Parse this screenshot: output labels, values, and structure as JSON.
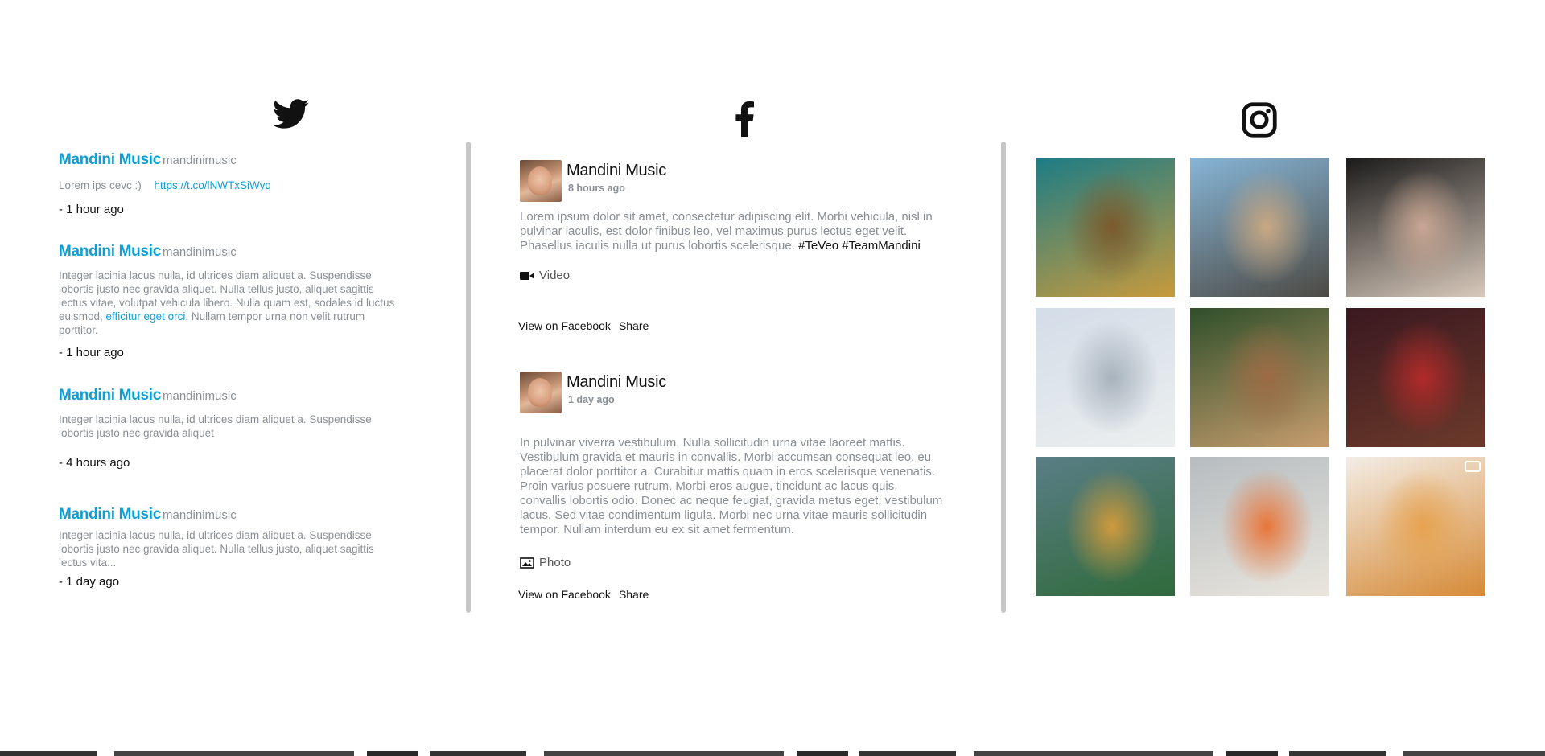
{
  "twitter": {
    "icon": "twitter-bird-icon",
    "tweets": [
      {
        "name": "Mandini Music",
        "handle": "mandinimusic",
        "text": "Lorem ips cevc :) ",
        "link": "https://t.co/lNWTxSiWyq",
        "time": "- 1 hour ago"
      },
      {
        "name": "Mandini Music",
        "handle": "mandinimusic",
        "text": "Integer lacinia lacus nulla, id ultrices diam aliquet a. Suspendisse lobortis justo nec gravida aliquet. Nulla tellus justo, aliquet sagittis lectus vitae, volutpat vehicula libero. Nulla quam est, sodales id luctus euismod, ",
        "link": "efficitur eget orci",
        "text_after": ". Nullam tempor urna non velit rutrum porttitor.",
        "time": "- 1 hour ago"
      },
      {
        "name": "Mandini Music",
        "handle": "mandinimusic",
        "text": "Integer lacinia lacus nulla, id ultrices diam aliquet a. Suspendisse lobortis justo nec gravida aliquet",
        "time": "- 4 hours ago"
      },
      {
        "name": "Mandini Music",
        "handle": "mandinimusic",
        "text": "Integer lacinia lacus nulla, id ultrices diam aliquet a. Suspendisse lobortis justo nec gravida aliquet. Nulla tellus justo, aliquet sagittis lectus vita...",
        "time": "- 1 day ago"
      }
    ]
  },
  "facebook": {
    "icon": "facebook-icon",
    "posts": [
      {
        "name": "Mandini Music",
        "time": "8 hours ago",
        "text": "Lorem ipsum dolor sit amet, consectetur adipiscing elit. Morbi vehicula, nisl in pulvinar iaculis, est dolor finibus leo, vel maximus purus lectus eget velit. Phasellus iaculis nulla ut purus lobortis scelerisque. ",
        "tags": "#TeVeo #TeamMandini",
        "media_label": "Video",
        "media_icon": "video-camera-icon",
        "view_label": "View on Facebook",
        "share_label": "Share"
      },
      {
        "name": "Mandini Music",
        "time": "1 day ago",
        "text": "In pulvinar viverra vestibulum. Nulla sollicitudin urna vitae laoreet mattis. Vestibulum gravida et mauris in convallis. Morbi accumsan consequat leo, eu placerat dolor porttitor a. Curabitur mattis quam in eros scelerisque venenatis. Proin varius posuere rutrum. Morbi eros augue, tincidunt ac lacus quis, convallis lobortis odio. Donec ac neque feugiat, gravida metus eget, vestibulum lacus. Sed vitae condimentum ligula. Morbi nec urna vitae mauris sollicitudin tempor. Nullam interdum eu ex sit amet fermentum.",
        "media_label": "Photo",
        "media_icon": "image-icon",
        "view_label": "View on Facebook",
        "share_label": "Share"
      }
    ]
  },
  "instagram": {
    "icon": "instagram-icon",
    "tiles": [
      {
        "name": "instagram-photo-album-cover",
        "colors": [
          "#1c7c86",
          "#7a5a2c",
          "#c79a3c"
        ]
      },
      {
        "name": "instagram-photo-friends-dock",
        "colors": [
          "#86b5d6",
          "#c9a882",
          "#4d4a44"
        ]
      },
      {
        "name": "instagram-photo-couple",
        "colors": [
          "#1a1a1a",
          "#c9a693",
          "#d8c9bb"
        ]
      },
      {
        "name": "instagram-photo-plaza",
        "colors": [
          "#d3dde8",
          "#a8b3bd",
          "#ecefef"
        ]
      },
      {
        "name": "instagram-photo-park-selfie",
        "colors": [
          "#2f4f2a",
          "#9c6b45",
          "#c79d6e"
        ]
      },
      {
        "name": "instagram-photo-mirror-selfie",
        "colors": [
          "#3a1820",
          "#b12a2a",
          "#6c3a2a"
        ]
      },
      {
        "name": "instagram-photo-beach",
        "colors": [
          "#5a7e86",
          "#cf9a3c",
          "#2f6a3a"
        ]
      },
      {
        "name": "instagram-photo-food",
        "colors": [
          "#b6bcc0",
          "#e8763a",
          "#eae6de"
        ]
      },
      {
        "name": "instagram-video-dog",
        "colors": [
          "#f3ede6",
          "#e6a350",
          "#d68a36"
        ],
        "video_icon": "video-camera-icon"
      }
    ]
  }
}
